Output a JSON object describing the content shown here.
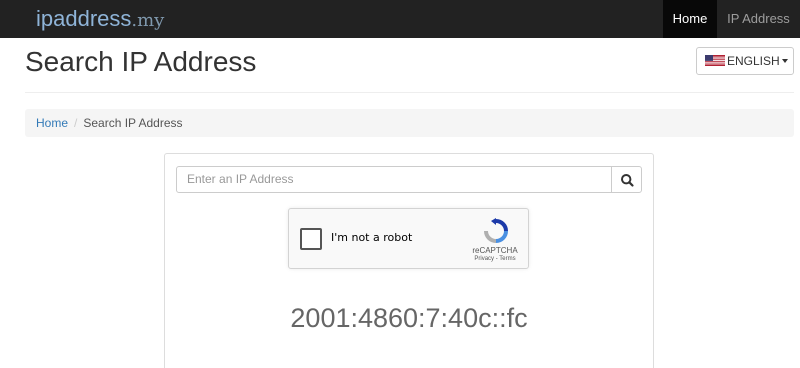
{
  "navbar": {
    "brand_name": "ipaddress",
    "brand_tld": ".my",
    "items": [
      {
        "label": "Home",
        "active": true
      },
      {
        "label": "IP Address",
        "active": false
      }
    ]
  },
  "header": {
    "title": "Search IP Address",
    "language_button": "ENGLISH",
    "language_flag_icon": "us-flag-icon"
  },
  "breadcrumb": {
    "home": "Home",
    "current": "Search IP Address"
  },
  "search": {
    "placeholder": "Enter an IP Address",
    "button_icon": "search-icon"
  },
  "recaptcha": {
    "label": "I'm not a robot",
    "brand": "reCAPTCHA",
    "terms": "Privacy - Terms"
  },
  "result": {
    "ip": "2001:4860:7:40c::fc"
  },
  "colors": {
    "navbar_bg": "#222222",
    "brand": "#8fb4d8",
    "link": "#337ab7"
  }
}
